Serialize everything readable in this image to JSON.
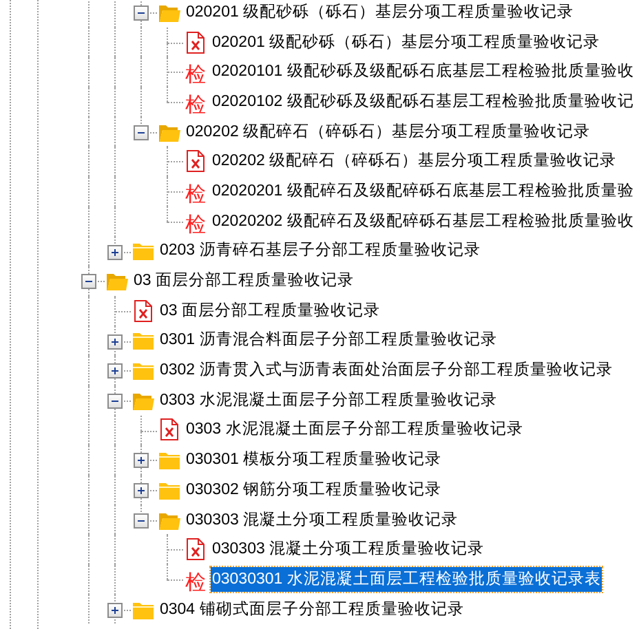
{
  "tree": [
    {
      "children": [
        {
          "children": [
            {
              "kind": "folder",
              "label": "020201  级配砂砾（砾石）基层分项工程质量验收记录",
              "expanded": true,
              "selected": false,
              "children": [
                {
                  "kind": "form",
                  "label": "020201  级配砂砾（砾石）基层分项工程质量验收记录",
                  "selected": false
                },
                {
                  "kind": "check",
                  "icon": "检",
                  "label": "02020101  级配砂砾及级配砾石底基层工程检验批质量验收",
                  "selected": false
                },
                {
                  "kind": "check",
                  "icon": "检",
                  "label": "02020102  级配砂砾及级配砾石基层工程检验批质量验收记",
                  "selected": false
                }
              ]
            },
            {
              "kind": "folder",
              "label": "020202  级配碎石（碎砾石）基层分项工程质量验收记录",
              "expanded": true,
              "selected": false,
              "children": [
                {
                  "kind": "form",
                  "label": "020202  级配碎石（碎砾石）基层分项工程质量验收记录",
                  "selected": false
                },
                {
                  "kind": "check",
                  "icon": "检",
                  "label": "02020201  级配碎石及级配碎砾石底基层工程检验批质量验",
                  "selected": false
                },
                {
                  "kind": "check",
                  "icon": "检",
                  "label": "02020202  级配碎石及级配碎砾石基层工程检验批质量验收",
                  "selected": false
                }
              ]
            }
          ]
        },
        {
          "kind": "folder",
          "label": "0203  沥青碎石基层子分部工程质量验收记录",
          "expanded": false,
          "selected": false
        }
      ]
    },
    {
      "kind": "folder",
      "label": "03  面层分部工程质量验收记录",
      "expanded": true,
      "selected": false,
      "children": [
        {
          "kind": "form",
          "label": "03  面层分部工程质量验收记录",
          "selected": false
        },
        {
          "kind": "folder",
          "label": "0301  沥青混合料面层子分部工程质量验收记录",
          "expanded": false,
          "selected": false
        },
        {
          "kind": "folder",
          "label": "0302  沥青贯入式与沥青表面处治面层子分部工程质量验收记录",
          "expanded": false,
          "selected": false
        },
        {
          "kind": "folder",
          "label": "0303  水泥混凝土面层子分部工程质量验收记录",
          "expanded": true,
          "selected": false,
          "children": [
            {
              "kind": "form",
              "label": "0303  水泥混凝土面层子分部工程质量验收记录",
              "selected": false
            },
            {
              "kind": "folder",
              "label": "030301  模板分项工程质量验收记录",
              "expanded": false,
              "selected": false
            },
            {
              "kind": "folder",
              "label": "030302  钢筋分项工程质量验收记录",
              "expanded": false,
              "selected": false
            },
            {
              "kind": "folder",
              "label": "030303  混凝土分项工程质量验收记录",
              "expanded": true,
              "selected": false,
              "children": [
                {
                  "kind": "form",
                  "label": "030303  混凝土分项工程质量验收记录",
                  "selected": false
                },
                {
                  "kind": "check",
                  "icon": "检",
                  "label": "03030301  水泥混凝土面层工程检验批质量验收记录表",
                  "selected": true
                }
              ]
            }
          ]
        },
        {
          "kind": "folder",
          "label": "0304  铺砌式面层子分部工程质量验收记录",
          "expanded": false,
          "selected": false
        }
      ]
    }
  ]
}
